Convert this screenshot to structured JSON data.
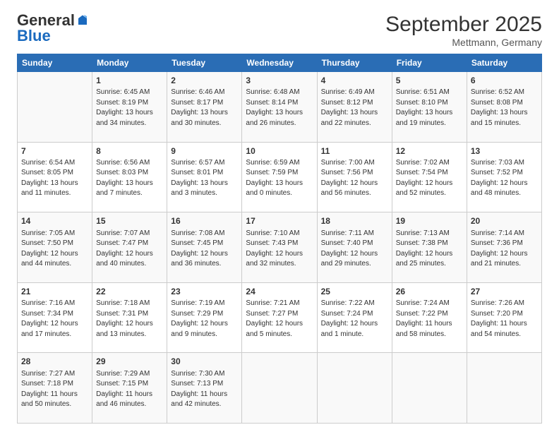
{
  "header": {
    "logo_general": "General",
    "logo_blue": "Blue",
    "month": "September 2025",
    "location": "Mettmann, Germany"
  },
  "days": [
    "Sunday",
    "Monday",
    "Tuesday",
    "Wednesday",
    "Thursday",
    "Friday",
    "Saturday"
  ],
  "rows": [
    [
      {
        "day": "",
        "info": ""
      },
      {
        "day": "1",
        "info": "Sunrise: 6:45 AM\nSunset: 8:19 PM\nDaylight: 13 hours\nand 34 minutes."
      },
      {
        "day": "2",
        "info": "Sunrise: 6:46 AM\nSunset: 8:17 PM\nDaylight: 13 hours\nand 30 minutes."
      },
      {
        "day": "3",
        "info": "Sunrise: 6:48 AM\nSunset: 8:14 PM\nDaylight: 13 hours\nand 26 minutes."
      },
      {
        "day": "4",
        "info": "Sunrise: 6:49 AM\nSunset: 8:12 PM\nDaylight: 13 hours\nand 22 minutes."
      },
      {
        "day": "5",
        "info": "Sunrise: 6:51 AM\nSunset: 8:10 PM\nDaylight: 13 hours\nand 19 minutes."
      },
      {
        "day": "6",
        "info": "Sunrise: 6:52 AM\nSunset: 8:08 PM\nDaylight: 13 hours\nand 15 minutes."
      }
    ],
    [
      {
        "day": "7",
        "info": "Sunrise: 6:54 AM\nSunset: 8:05 PM\nDaylight: 13 hours\nand 11 minutes."
      },
      {
        "day": "8",
        "info": "Sunrise: 6:56 AM\nSunset: 8:03 PM\nDaylight: 13 hours\nand 7 minutes."
      },
      {
        "day": "9",
        "info": "Sunrise: 6:57 AM\nSunset: 8:01 PM\nDaylight: 13 hours\nand 3 minutes."
      },
      {
        "day": "10",
        "info": "Sunrise: 6:59 AM\nSunset: 7:59 PM\nDaylight: 13 hours\nand 0 minutes."
      },
      {
        "day": "11",
        "info": "Sunrise: 7:00 AM\nSunset: 7:56 PM\nDaylight: 12 hours\nand 56 minutes."
      },
      {
        "day": "12",
        "info": "Sunrise: 7:02 AM\nSunset: 7:54 PM\nDaylight: 12 hours\nand 52 minutes."
      },
      {
        "day": "13",
        "info": "Sunrise: 7:03 AM\nSunset: 7:52 PM\nDaylight: 12 hours\nand 48 minutes."
      }
    ],
    [
      {
        "day": "14",
        "info": "Sunrise: 7:05 AM\nSunset: 7:50 PM\nDaylight: 12 hours\nand 44 minutes."
      },
      {
        "day": "15",
        "info": "Sunrise: 7:07 AM\nSunset: 7:47 PM\nDaylight: 12 hours\nand 40 minutes."
      },
      {
        "day": "16",
        "info": "Sunrise: 7:08 AM\nSunset: 7:45 PM\nDaylight: 12 hours\nand 36 minutes."
      },
      {
        "day": "17",
        "info": "Sunrise: 7:10 AM\nSunset: 7:43 PM\nDaylight: 12 hours\nand 32 minutes."
      },
      {
        "day": "18",
        "info": "Sunrise: 7:11 AM\nSunset: 7:40 PM\nDaylight: 12 hours\nand 29 minutes."
      },
      {
        "day": "19",
        "info": "Sunrise: 7:13 AM\nSunset: 7:38 PM\nDaylight: 12 hours\nand 25 minutes."
      },
      {
        "day": "20",
        "info": "Sunrise: 7:14 AM\nSunset: 7:36 PM\nDaylight: 12 hours\nand 21 minutes."
      }
    ],
    [
      {
        "day": "21",
        "info": "Sunrise: 7:16 AM\nSunset: 7:34 PM\nDaylight: 12 hours\nand 17 minutes."
      },
      {
        "day": "22",
        "info": "Sunrise: 7:18 AM\nSunset: 7:31 PM\nDaylight: 12 hours\nand 13 minutes."
      },
      {
        "day": "23",
        "info": "Sunrise: 7:19 AM\nSunset: 7:29 PM\nDaylight: 12 hours\nand 9 minutes."
      },
      {
        "day": "24",
        "info": "Sunrise: 7:21 AM\nSunset: 7:27 PM\nDaylight: 12 hours\nand 5 minutes."
      },
      {
        "day": "25",
        "info": "Sunrise: 7:22 AM\nSunset: 7:24 PM\nDaylight: 12 hours\nand 1 minute."
      },
      {
        "day": "26",
        "info": "Sunrise: 7:24 AM\nSunset: 7:22 PM\nDaylight: 11 hours\nand 58 minutes."
      },
      {
        "day": "27",
        "info": "Sunrise: 7:26 AM\nSunset: 7:20 PM\nDaylight: 11 hours\nand 54 minutes."
      }
    ],
    [
      {
        "day": "28",
        "info": "Sunrise: 7:27 AM\nSunset: 7:18 PM\nDaylight: 11 hours\nand 50 minutes."
      },
      {
        "day": "29",
        "info": "Sunrise: 7:29 AM\nSunset: 7:15 PM\nDaylight: 11 hours\nand 46 minutes."
      },
      {
        "day": "30",
        "info": "Sunrise: 7:30 AM\nSunset: 7:13 PM\nDaylight: 11 hours\nand 42 minutes."
      },
      {
        "day": "",
        "info": ""
      },
      {
        "day": "",
        "info": ""
      },
      {
        "day": "",
        "info": ""
      },
      {
        "day": "",
        "info": ""
      }
    ]
  ]
}
